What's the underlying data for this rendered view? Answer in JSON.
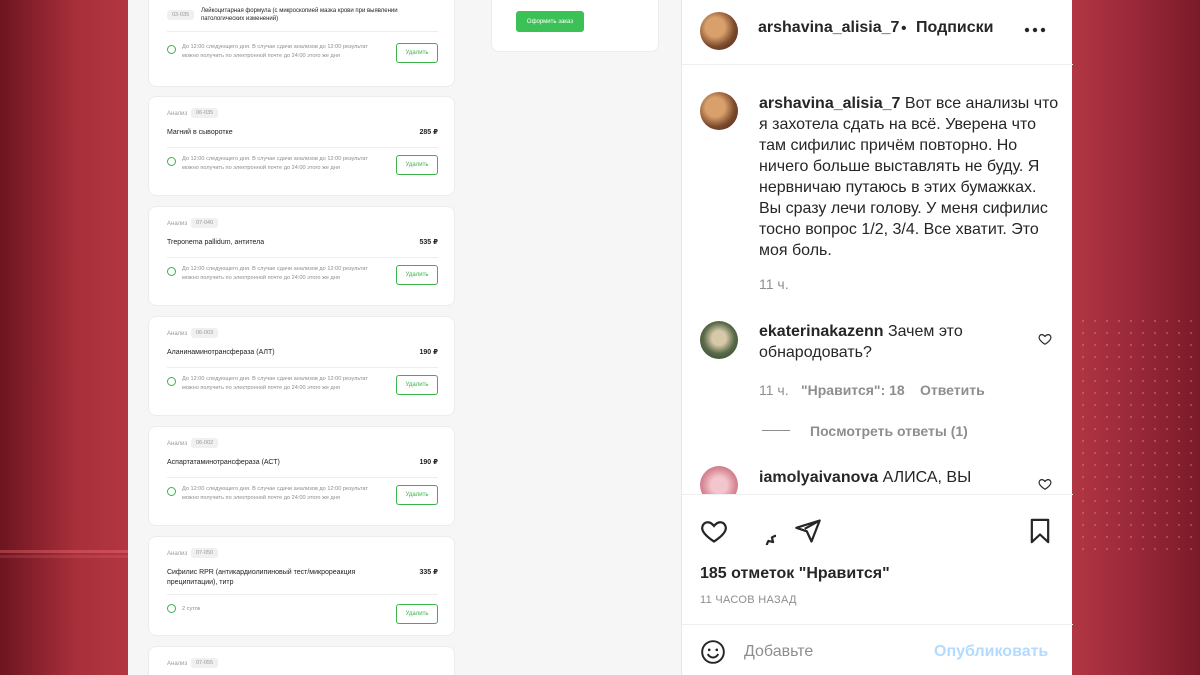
{
  "document": {
    "top_partial": {
      "code": "03-035",
      "name": "Лейкоцитарная формула (с микроскопией мазка крови при выявлении патологических изменений)",
      "note": "До 12:00 следующего дня. В случае сдачи анализов до 12:00 результат можно получить по электронной почте до 24:00 этого же дня",
      "delete_label": "Удалить"
    },
    "order_button_label": "Оформить заказ",
    "cards": [
      {
        "tag": "Анализ",
        "code": "06-035",
        "name": "Магний в сыворотке",
        "price": "285 ₽",
        "note": "До 12:00 следующего дня. В случае сдачи анализов до 12:00 результат можно получить по электронной почте до 24:00 этого же дня",
        "delete_label": "Удалить"
      },
      {
        "tag": "Анализ",
        "code": "07-040",
        "name": "Treponema pallidum, антитела",
        "price": "535 ₽",
        "note": "До 12:00 следующего дня. В случае сдачи анализов до 12:00 результат можно получить по электронной почте до 24:00 этого же дня",
        "delete_label": "Удалить"
      },
      {
        "tag": "Анализ",
        "code": "06-003",
        "name": "Аланинаминотрансфераза (АЛТ)",
        "price": "190 ₽",
        "note": "До 12:00 следующего дня. В случае сдачи анализов до 12:00 результат можно получить по электронной почте до 24:00 этого же дня",
        "delete_label": "Удалить"
      },
      {
        "tag": "Анализ",
        "code": "06-002",
        "name": "Аспартатаминотрансфераза (АСТ)",
        "price": "190 ₽",
        "note": "До 12:00 следующего дня. В случае сдачи анализов до 12:00 результат можно получить по электронной почте до 24:00 этого же дня",
        "delete_label": "Удалить"
      },
      {
        "tag": "Анализ",
        "code": "07-050",
        "name": "Сифилис RPR (антикардиолипиновый тест/микрореакция преципитации), титр",
        "price": "335 ₽",
        "note": "2 суток",
        "delete_label": "Удалить"
      },
      {
        "tag": "Анализ",
        "code": "07-055",
        "name": "",
        "price": "",
        "note": "",
        "delete_label": ""
      }
    ]
  },
  "instagram": {
    "header": {
      "username": "arshavina_alisia_7",
      "separator": "•",
      "follow_label": "Подписки",
      "more_icon": "more-horizontal-icon"
    },
    "caption": {
      "username": "arshavina_alisia_7",
      "text": "Вот все анализы что я захотела сдать на всё. Уверена что там сифилис причём повторно. Но ничего больше выставлять не буду. Я нервничаю путаюсь в этих бумажках. Вы сразу лечи голову. У меня сифилис тосно вопрос 1/2, 3/4. Все хватит. Это моя боль.",
      "time": "11 ч."
    },
    "comments": [
      {
        "username": "ekaterinakazenn",
        "text": "Зачем это обнародовать?",
        "time": "11 ч.",
        "likes": "\"Нравится\": 18",
        "reply": "Ответить",
        "view_replies": "Посмотреть ответы (1)"
      },
      {
        "username": "iamolyaivanova",
        "text": "АЛИСА, ВЫ"
      }
    ],
    "likes_text": "185 отметок \"Нравится\"",
    "timestamp": "11 ЧАСОВ НАЗАД",
    "add_comment_placeholder": "Добавьте",
    "publish_label": "Опубликовать",
    "colors": {
      "link_blue_disabled": "#b3dbff",
      "text": "#262626",
      "muted": "#8e8e8e",
      "green": "#39b34a"
    }
  }
}
